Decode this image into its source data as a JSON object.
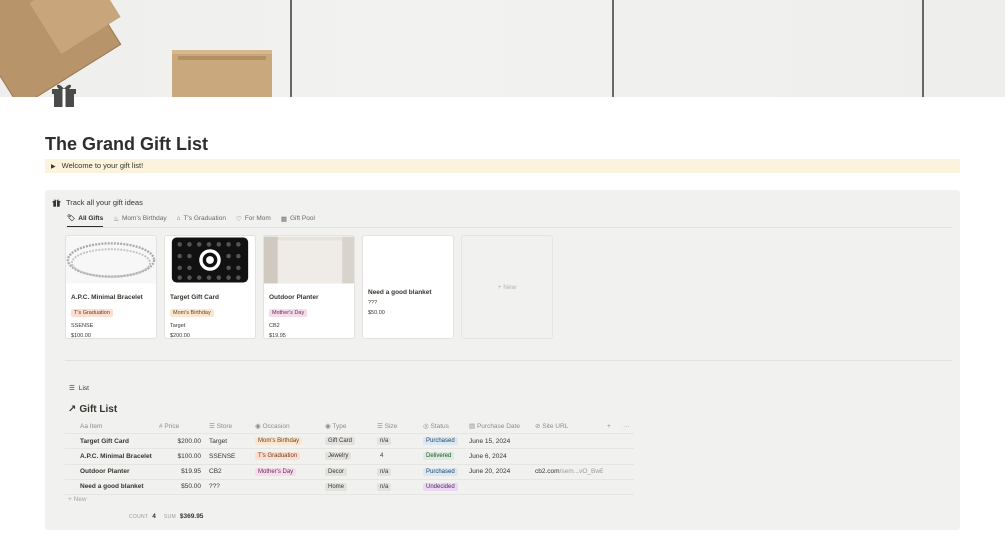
{
  "page": {
    "title": "The Grand Gift List",
    "callout_text": "Welcome to your gift list!"
  },
  "database": {
    "title": "Track all your gift ideas",
    "views": [
      {
        "label": "All Gifts",
        "icon": "tag-icon",
        "active": true
      },
      {
        "label": "Mom's Birthday",
        "icon": "cake-icon",
        "active": false
      },
      {
        "label": "T's Graduation",
        "icon": "graduation-cap-icon",
        "active": false
      },
      {
        "label": "For Mom",
        "icon": "heart-icon",
        "active": false
      },
      {
        "label": "Gift Pool",
        "icon": "grid-icon",
        "active": false
      }
    ],
    "cards": [
      {
        "title": "A.P.C. Minimal Bracelet",
        "tag": "T's Graduation",
        "store": "SSENSE",
        "price": "$100.00"
      },
      {
        "title": "Target Gift Card",
        "tag": "Mom's Birthday",
        "store": "Target",
        "price": "$200.00"
      },
      {
        "title": "Outdoor Planter",
        "tag": "Mother's Day",
        "store": "CB2",
        "price": "$19.95"
      },
      {
        "title": "Need a good blanket",
        "tag": "",
        "store": "???",
        "price": "$50.00"
      }
    ],
    "new_card_label": "+ New"
  },
  "list": {
    "view_label": "List",
    "title": "Gift List",
    "columns": [
      "Item",
      "Price",
      "Store",
      "Occasion",
      "Type",
      "Size",
      "Status",
      "Purchase Date",
      "Site URL"
    ],
    "rows": [
      {
        "item": "Target Gift Card",
        "price": "$200.00",
        "store": "Target",
        "occasion": "Mom's Birthday",
        "type": "Gift Card",
        "size": "n/a",
        "status": "Purchased",
        "date": "June 15, 2024",
        "url": "",
        "url_fade": ""
      },
      {
        "item": "A.P.C. Minimal Bracelet",
        "price": "$100.00",
        "store": "SSENSE",
        "occasion": "T's Graduation",
        "type": "Jewelry",
        "size": "4",
        "status": "Delivered",
        "date": "June 6, 2024",
        "url": "",
        "url_fade": ""
      },
      {
        "item": "Outdoor Planter",
        "price": "$19.95",
        "store": "CB2",
        "occasion": "Mother's Day",
        "type": "Decor",
        "size": "n/a",
        "status": "Purchased",
        "date": "June 20, 2024",
        "url": "cb2.com",
        "url_fade": "/sem...vO_BwE"
      },
      {
        "item": "Need a good blanket",
        "price": "$50.00",
        "store": "???",
        "occasion": "",
        "type": "Home",
        "size": "n/a",
        "status": "Undecided",
        "date": "",
        "url": "",
        "url_fade": ""
      }
    ],
    "new_row_label": "+ New",
    "count_label": "COUNT",
    "count_value": "4",
    "sum_label": "SUM",
    "sum_value": "$369.95"
  },
  "colors": {
    "occasion": {
      "Mom's Birthday": "#fbe6cf",
      "T's Graduation": "#fadfd1",
      "Mother's Day": "#f4dcea"
    },
    "occasion_text": {
      "Mom's Birthday": "#6a4418",
      "T's Graduation": "#6f3a20",
      "Mother's Day": "#6e2a52"
    },
    "status": {
      "Purchased": "#dbe7f3",
      "Delivered": "#dcebdf",
      "Undecided": "#ead9f1"
    },
    "status_text": {
      "Purchased": "#214866",
      "Delivered": "#1f4f2d",
      "Undecided": "#4f2a66"
    },
    "chip_bg": "#e3e2de"
  }
}
